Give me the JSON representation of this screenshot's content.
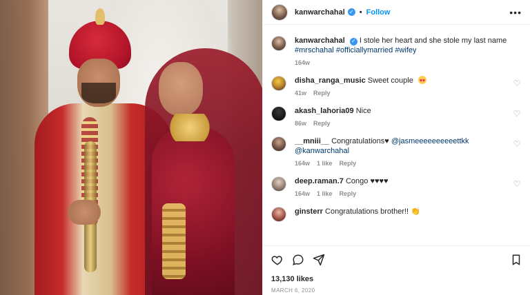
{
  "post": {
    "author": "kanwarchahal",
    "follow_label": "Follow",
    "caption": {
      "author": "kanwarchahal",
      "text": "I stole her heart and she stole my last name",
      "tags": [
        "#mrschahal",
        "#officiallymarried",
        "#wifey"
      ],
      "time": "164w"
    },
    "likes": "13,130 likes",
    "date": "MARCH 6, 2020"
  },
  "comments": [
    {
      "name": "disha_ranga_music",
      "text": "Sweet couple",
      "emoji": "heart-eyes",
      "time": "41w",
      "likes": "",
      "reply": "Reply"
    },
    {
      "name": "akash_lahoria09",
      "text": "Nice",
      "emoji": "",
      "time": "86w",
      "likes": "",
      "reply": "Reply"
    },
    {
      "name": "__mniii__",
      "text": "Congratulations♥",
      "mentions": [
        "@jasmeeeeeeeeeettkk",
        "@kanwarchahal"
      ],
      "time": "164w",
      "likes": "1 like",
      "reply": "Reply"
    },
    {
      "name": "deep.raman.7",
      "text": "Congo ♥♥♥♥",
      "time": "164w",
      "likes": "1 like",
      "reply": "Reply"
    },
    {
      "name": "ginsterr",
      "text": "Congratulations brother!! 👏"
    }
  ],
  "colors": {
    "follow": "#0095f6",
    "verified": "#3897f0",
    "muted": "#8e8e8e",
    "text": "#262626",
    "tag": "#00376b"
  },
  "icons": {
    "more": "ellipsis-icon",
    "like": "heart-outline-icon",
    "comment": "comment-icon",
    "share": "paper-plane-icon",
    "save": "bookmark-icon",
    "verified": "verified-badge-icon"
  }
}
